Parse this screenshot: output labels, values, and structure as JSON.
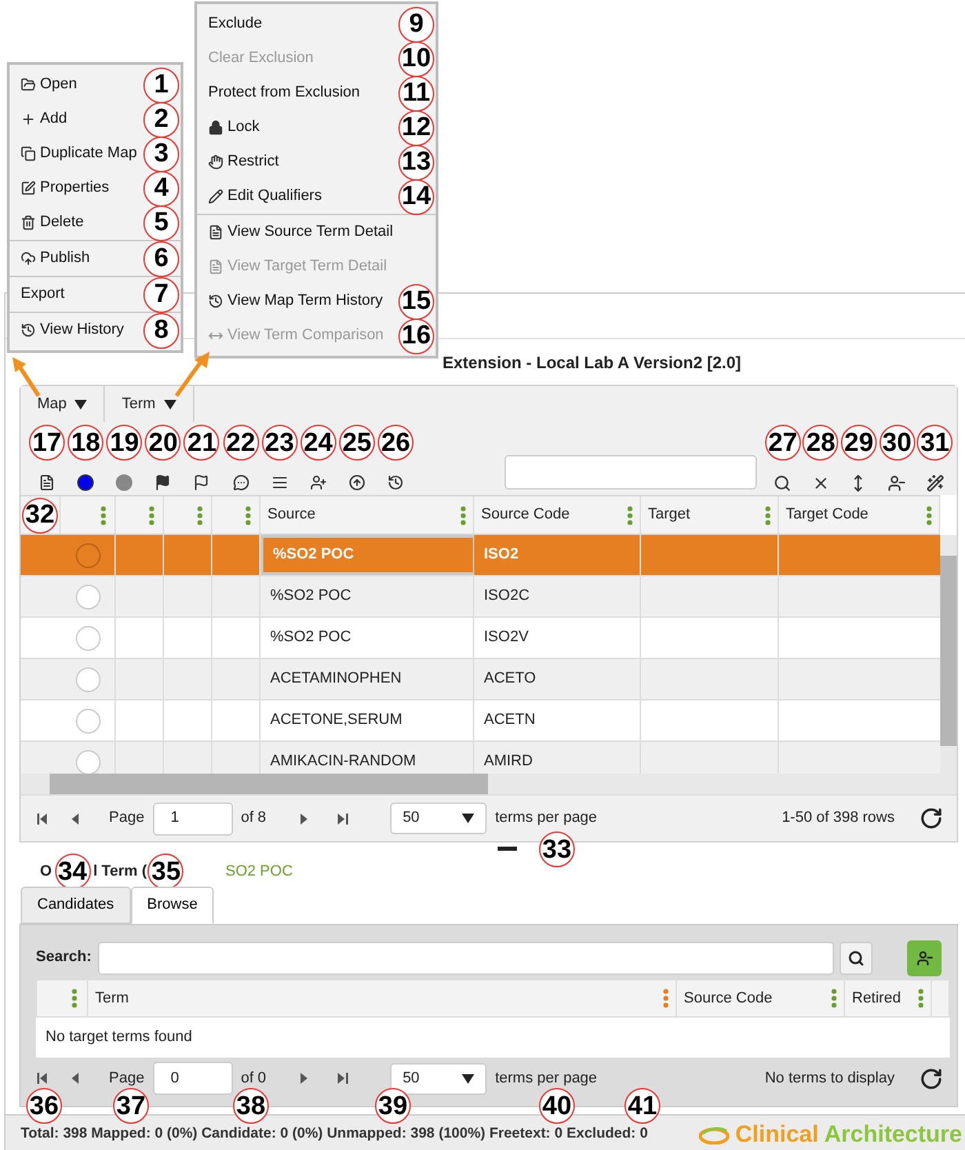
{
  "map_menu": {
    "groups": [
      [
        {
          "label": "Open",
          "callout": "1",
          "disabled": false
        },
        {
          "label": "Add",
          "callout": "2",
          "disabled": false
        },
        {
          "label": "Duplicate Map",
          "callout": "3",
          "disabled": false
        },
        {
          "label": "Properties",
          "callout": "4",
          "disabled": false
        },
        {
          "label": "Delete",
          "callout": "5",
          "disabled": false
        }
      ],
      [
        {
          "label": "Publish",
          "callout": "6",
          "disabled": false
        }
      ],
      [
        {
          "label": "Export",
          "callout": "7",
          "disabled": false
        }
      ],
      [
        {
          "label": "View History",
          "callout": "8",
          "disabled": false
        }
      ]
    ]
  },
  "term_menu": {
    "groups": [
      [
        {
          "label": "Exclude",
          "callout": "9",
          "disabled": false
        },
        {
          "label": "Clear Exclusion",
          "callout": "10",
          "disabled": true
        },
        {
          "label": "Protect from Exclusion",
          "callout": "11",
          "disabled": false
        },
        {
          "label": "Lock",
          "callout": "12",
          "disabled": false
        },
        {
          "label": "Restrict",
          "callout": "13",
          "disabled": false
        },
        {
          "label": "Edit Qualifiers",
          "callout": "14",
          "disabled": false
        }
      ],
      [
        {
          "label": "View Source Term Detail",
          "disabled": false
        },
        {
          "label": "View Target Term Detail",
          "disabled": true
        },
        {
          "label": "View Map Term History",
          "callout": "15",
          "disabled": false
        },
        {
          "label": "View Term Comparison",
          "callout": "16",
          "disabled": true
        }
      ]
    ]
  },
  "page": {
    "title": "Extension - Local Lab A Version2 [2.0]"
  },
  "menu_bar": [
    {
      "label": "Map"
    },
    {
      "label": "Term"
    }
  ],
  "toolbar": {
    "left_callouts": [
      "17",
      "18",
      "19",
      "20",
      "21",
      "22",
      "23",
      "24",
      "25",
      "26"
    ],
    "right_callouts": [
      "27",
      "28",
      "29",
      "30",
      "31"
    ]
  },
  "grid": {
    "callout": "32",
    "columns": [
      {
        "label": "Source"
      },
      {
        "label": "Source Code"
      },
      {
        "label": "Target"
      },
      {
        "label": "Target Code"
      }
    ],
    "rows": [
      {
        "source": "%SO2 POC",
        "source_code": "ISO2",
        "selected": true
      },
      {
        "source": "%SO2 POC",
        "source_code": "ISO2C",
        "selected": false
      },
      {
        "source": "%SO2 POC",
        "source_code": "ISO2V",
        "selected": false
      },
      {
        "source": "ACETAMINOPHEN",
        "source_code": "ACETO",
        "selected": false
      },
      {
        "source": "ACETONE,SERUM",
        "source_code": "ACETN",
        "selected": false
      },
      {
        "source": "AMIKACIN-RANDOM",
        "source_code": "AMIRD",
        "selected": false
      }
    ],
    "pager": {
      "page_label": "Page",
      "page": "1",
      "of": "of 8",
      "per_page": "50",
      "per_page_label": "terms per page",
      "summary": "1-50 of 398 rows"
    }
  },
  "splitter_callout": "33",
  "original_term": {
    "label_start": "O",
    "label_end": "l Term (",
    "callouts": [
      "34",
      "35"
    ],
    "value": "SO2 POC"
  },
  "tabs": [
    {
      "label": "Candidates",
      "selected": false
    },
    {
      "label": "Browse",
      "selected": true
    }
  ],
  "browse": {
    "search_label": "Search:",
    "columns": [
      {
        "label": "Term",
        "sorted": true
      },
      {
        "label": "Source Code",
        "sorted": false
      },
      {
        "label": "Retired",
        "sorted": false
      }
    ],
    "empty": "No target terms found",
    "pager": {
      "page_label": "Page",
      "page": "0",
      "of": "of 0",
      "per_page": "50",
      "per_page_label": "terms per page",
      "summary": "No terms to display"
    }
  },
  "bottom_callouts": [
    "36",
    "37",
    "38",
    "39",
    "40",
    "41"
  ],
  "status": {
    "text": "Total: 398 Mapped: 0 (0%) Candidate: 0 (0%) Unmapped: 398 (100%) Freetext: 0 Excluded: 0",
    "logo_first": "Clinical",
    "logo_second": "Architecture"
  }
}
